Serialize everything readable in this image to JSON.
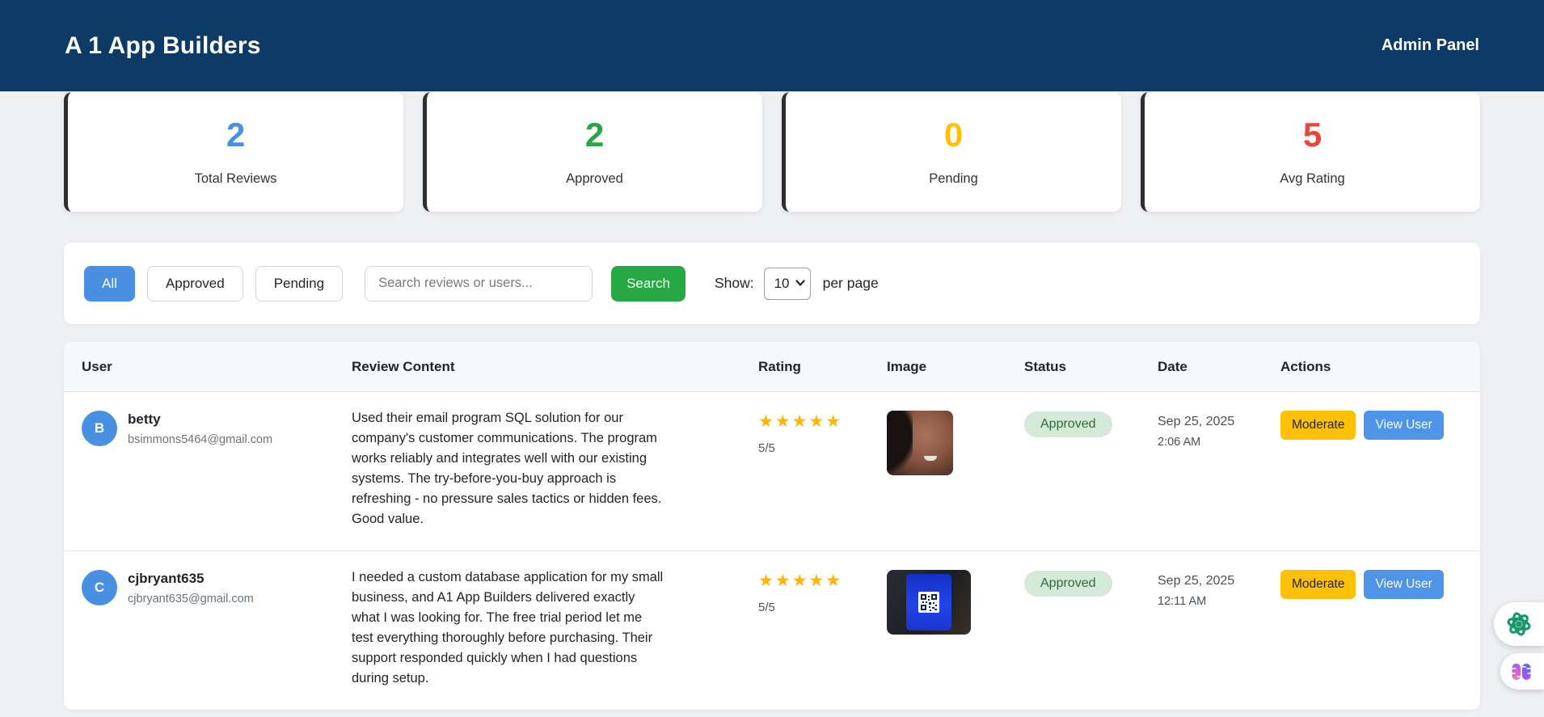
{
  "header": {
    "title": "A 1 App Builders",
    "right_label": "Admin Panel"
  },
  "colors": {
    "header_bg": "#0e3a66",
    "total_reviews": "#4a90e2",
    "approved": "#28a745",
    "pending": "#ffc107",
    "avg_rating": "#e8453c",
    "search_button": "#28a745",
    "active_filter": "#4a90e2",
    "moderate_button": "#ffc107",
    "view_user_button": "#4e95ea",
    "status_badge_bg": "#d4e9d8",
    "status_badge_text": "#2f6b3a",
    "stars": "#ffb302"
  },
  "stats": [
    {
      "value": "2",
      "label": "Total Reviews",
      "color": "#4a90e2"
    },
    {
      "value": "2",
      "label": "Approved",
      "color": "#28a745"
    },
    {
      "value": "0",
      "label": "Pending",
      "color": "#ffc107"
    },
    {
      "value": "5",
      "label": "Avg Rating",
      "color": "#e8453c"
    }
  ],
  "filters": {
    "all_label": "All",
    "approved_label": "Approved",
    "pending_label": "Pending",
    "search_placeholder": "Search reviews or users...",
    "search_button": "Search",
    "show_label": "Show:",
    "per_page_value": "10",
    "per_page_suffix": "per page"
  },
  "table": {
    "columns": [
      "User",
      "Review Content",
      "Rating",
      "Image",
      "Status",
      "Date",
      "Actions"
    ],
    "rows": [
      {
        "avatar_letter": "B",
        "username": "betty",
        "email": "bsimmons5464@gmail.com",
        "review": "Used their email program SQL solution for our company's customer communications. The program works reliably and integrates well with our existing systems. The try-before-you-buy approach is refreshing - no pressure sales tactics or hidden fees. Good value.",
        "stars": "★★★★★",
        "rating": "5/5",
        "image": "reviewer-portrait-photo",
        "status": "Approved",
        "date": "Sep 25, 2025",
        "time": "2:06 AM",
        "moderate_label": "Moderate",
        "view_user_label": "View User"
      },
      {
        "avatar_letter": "C",
        "username": "cjbryant635",
        "email": "cjbryant635@gmail.com",
        "review": "I needed a custom database application for my small business, and A1 App Builders delivered exactly what I was looking for. The free trial period let me test everything thoroughly before purchasing. Their support responded quickly when I had questions during setup.",
        "stars": "★★★★★",
        "rating": "5/5",
        "image": "phone-qr-code-photo",
        "status": "Approved",
        "date": "Sep 25, 2025",
        "time": "12:11 AM",
        "moderate_label": "Moderate",
        "view_user_label": "View User"
      }
    ]
  },
  "floating": {
    "icon1": "ai-extension-icon",
    "icon2": "brain-extension-icon"
  }
}
